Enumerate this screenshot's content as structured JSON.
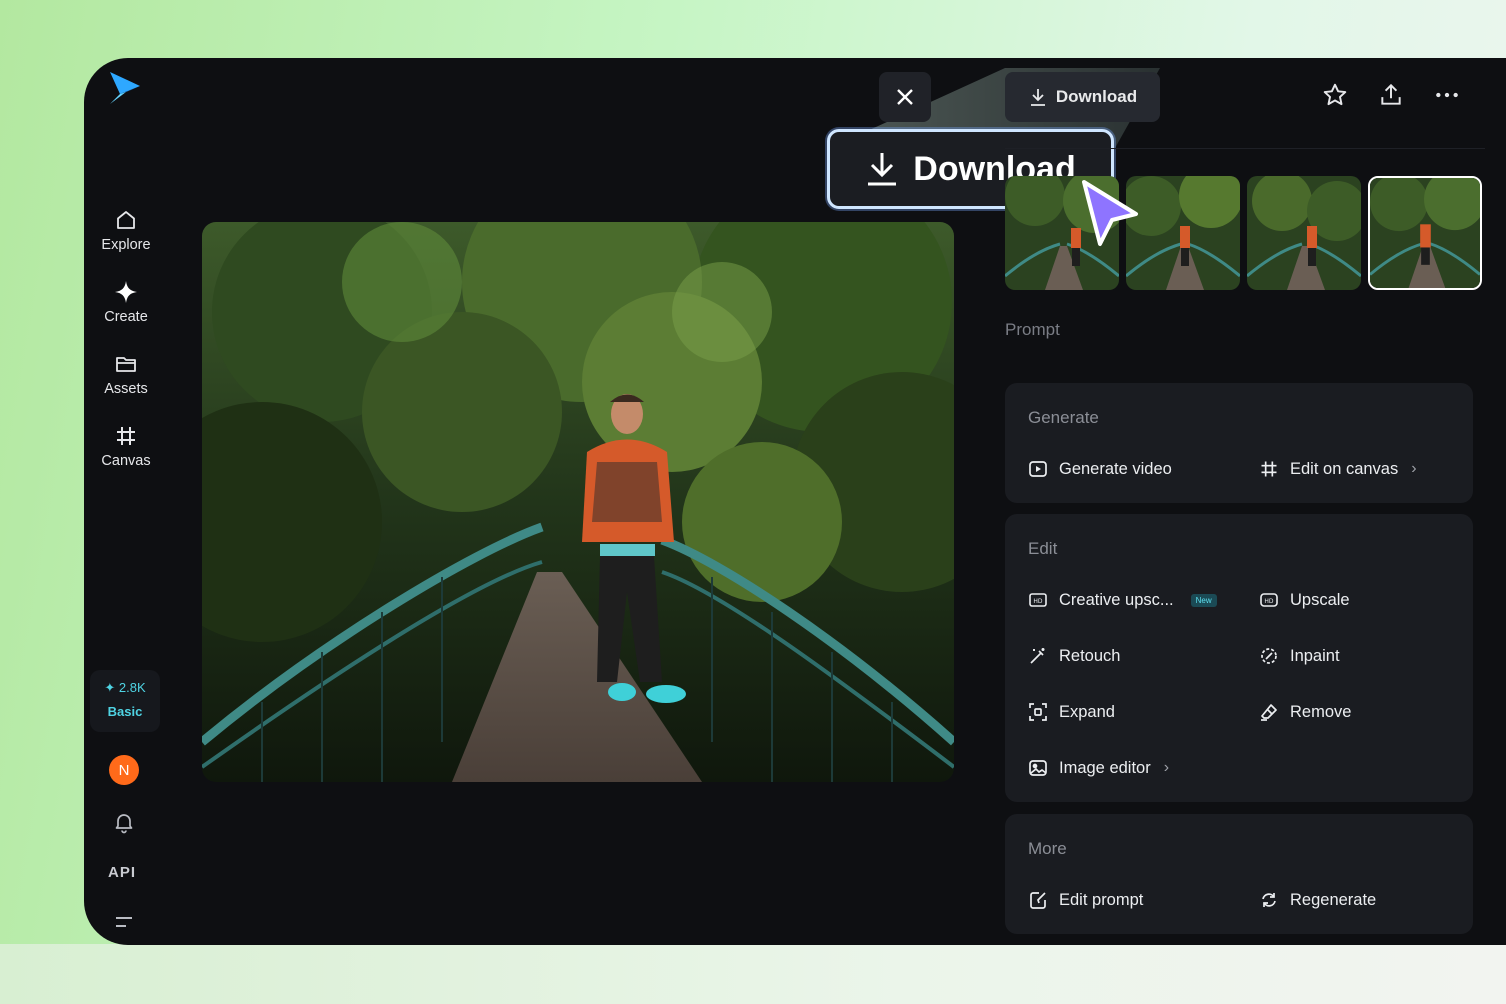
{
  "sidebar": {
    "items": [
      {
        "label": "Explore",
        "icon": "home-icon"
      },
      {
        "label": "Create",
        "icon": "sparkle-icon"
      },
      {
        "label": "Assets",
        "icon": "folder-icon"
      },
      {
        "label": "Canvas",
        "icon": "canvas-icon"
      }
    ],
    "credits": {
      "amount": "2.8K",
      "plan": "Basic"
    },
    "avatar_initial": "N",
    "api_label": "API"
  },
  "toolbar": {
    "download_label": "Download",
    "download_callout_label": "Download"
  },
  "prompt_label": "Prompt",
  "panels": {
    "generate": {
      "title": "Generate",
      "actions": [
        {
          "label": "Generate video"
        },
        {
          "label": "Edit on canvas"
        }
      ]
    },
    "edit": {
      "title": "Edit",
      "new_badge": "New",
      "actions": [
        {
          "label": "Creative upsc..."
        },
        {
          "label": "Upscale"
        },
        {
          "label": "Retouch"
        },
        {
          "label": "Inpaint"
        },
        {
          "label": "Expand"
        },
        {
          "label": "Remove"
        },
        {
          "label": "Image editor"
        }
      ]
    },
    "more": {
      "title": "More",
      "actions": [
        {
          "label": "Edit prompt"
        },
        {
          "label": "Regenerate"
        }
      ]
    }
  },
  "colors": {
    "app_bg": "#0e0f12",
    "panel_bg": "#1a1c21",
    "accent_cyan": "#4fd3e3",
    "avatar": "#ff6a1a",
    "cursor": "#8e74ff"
  }
}
